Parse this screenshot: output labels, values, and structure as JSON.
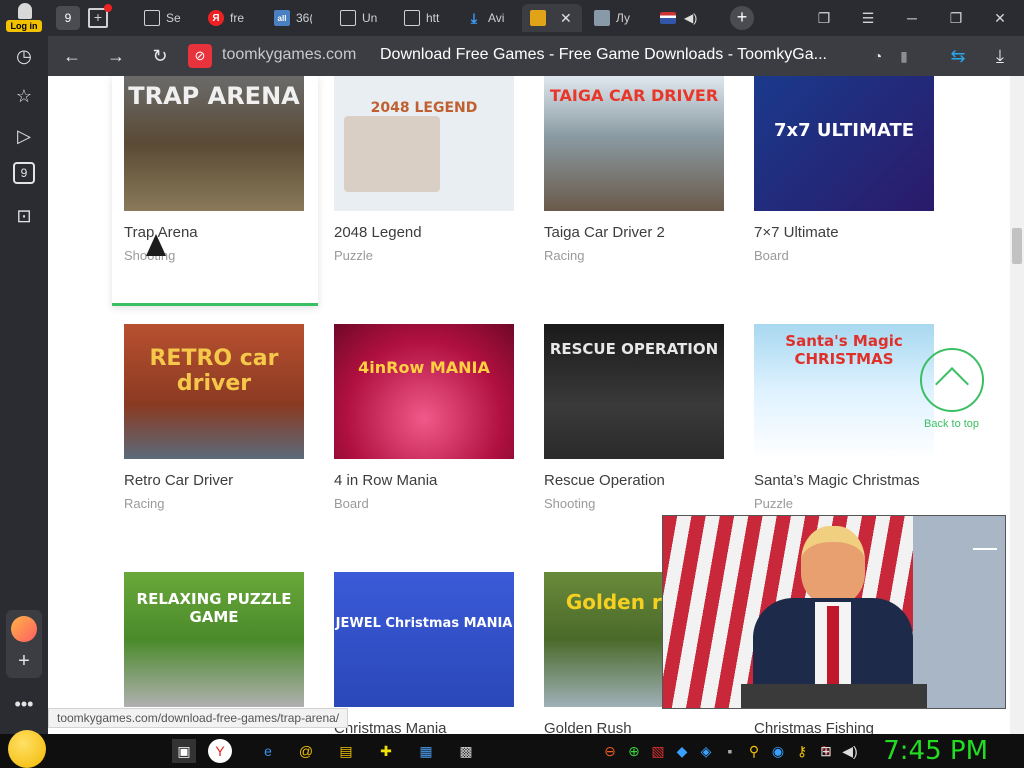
{
  "browser": {
    "login_label": "Log in",
    "tab_counter": "9",
    "tabs": [
      {
        "title": "Se",
        "color": "#cfd0d4",
        "icon": "page-icon"
      },
      {
        "title": "fre",
        "color": "#ee2222",
        "icon": "yandex-icon"
      },
      {
        "title": "36(",
        "color": "#4a7fc1",
        "icon": "all-icon"
      },
      {
        "title": "Un",
        "color": "#cfd0d4",
        "icon": "page-icon"
      },
      {
        "title": "htt",
        "color": "#cfd0d4",
        "icon": "page-icon"
      },
      {
        "title": "Avi",
        "color": "#3aa0ff",
        "icon": "download-icon"
      },
      {
        "title": "",
        "color": "#e1a318",
        "icon": "game-icon"
      },
      {
        "title": "Лу",
        "color": "#8899aa",
        "icon": "news-icon"
      },
      {
        "title": "",
        "color": "#cc3333",
        "icon": "flag-icon"
      }
    ],
    "domain": "toomkygames.com",
    "page_title": "Download Free Games - Free Game Downloads - ToomkyGa...",
    "sidebar_badge": "9",
    "status_url": "toomkygames.com/download-free-games/trap-arena/",
    "accent_color": "#3bbf63"
  },
  "games": [
    {
      "title": "Trap Arena",
      "category": "Shooting",
      "thumb_text": "TRAP ARENA",
      "bg": "#6b5a45"
    },
    {
      "title": "2048 Legend",
      "category": "Puzzle",
      "thumb_text": "2048 LEGEND",
      "bg": "#e8eef2"
    },
    {
      "title": "Taiga Car Driver 2",
      "category": "Racing",
      "thumb_text": "TAIGA CAR DRIVER",
      "bg": "#7a8a93"
    },
    {
      "title": "7×7 Ultimate",
      "category": "Board",
      "thumb_text": "7x7 ULTIMATE",
      "bg": "#1a3a8c"
    },
    {
      "title": "Retro Car Driver",
      "category": "Racing",
      "thumb_text": "RETRO car driver",
      "bg": "#8a3a22"
    },
    {
      "title": "4 in Row Mania",
      "category": "Board",
      "thumb_text": "4inRow MANIA",
      "bg": "#b01040"
    },
    {
      "title": "Rescue Operation",
      "category": "Shooting",
      "thumb_text": "RESCUE OPERATION",
      "bg": "#2a2a2a"
    },
    {
      "title": "Santa’s Magic Christmas",
      "category": "Puzzle",
      "thumb_text": "Santa's Magic CHRISTMAS",
      "bg": "#dff2ff"
    },
    {
      "title": "",
      "category": "",
      "thumb_text": "RELAXING PUZZLE GAME",
      "bg": "#6aa83a"
    },
    {
      "title": "Christmas Mania",
      "category": "",
      "thumb_text": "JEWEL Christmas MANIA",
      "bg": "#2a48b8"
    },
    {
      "title": "Golden Rush",
      "category": "",
      "thumb_text": "Golden rush",
      "bg": "#4a6a2a"
    },
    {
      "title": "Christmas Fishing",
      "category": "",
      "thumb_text": "",
      "bg": "#ffffff"
    }
  ],
  "back_to_top": "Back to top",
  "taskbar": {
    "clock": "7:45 PM"
  }
}
